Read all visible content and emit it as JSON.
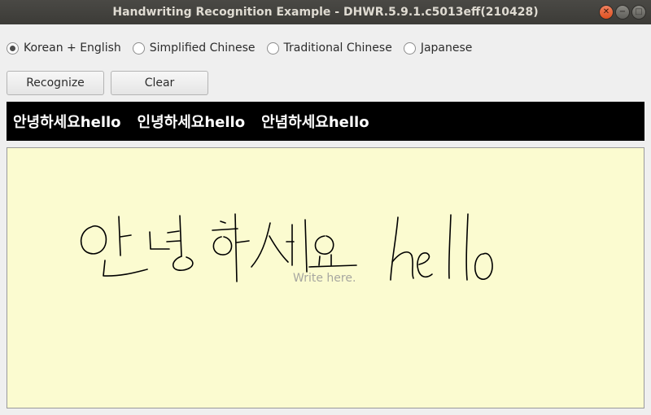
{
  "window": {
    "title": "Handwriting Recognition Example - DHWR.5.9.1.c5013eff(210428)",
    "minimize_icon": "minimize-icon",
    "maximize_icon": "maximize-icon",
    "close_icon": "close-icon"
  },
  "languages": [
    {
      "label": "Korean + English",
      "selected": true
    },
    {
      "label": "Simplified Chinese",
      "selected": false
    },
    {
      "label": "Traditional Chinese",
      "selected": false
    },
    {
      "label": "Japanese",
      "selected": false
    }
  ],
  "buttons": {
    "recognize": "Recognize",
    "clear": "Clear"
  },
  "results": [
    "안녕하세요hello",
    "인녕하세요hello",
    "안념하세요hello"
  ],
  "canvas": {
    "placeholder": "Write here."
  }
}
